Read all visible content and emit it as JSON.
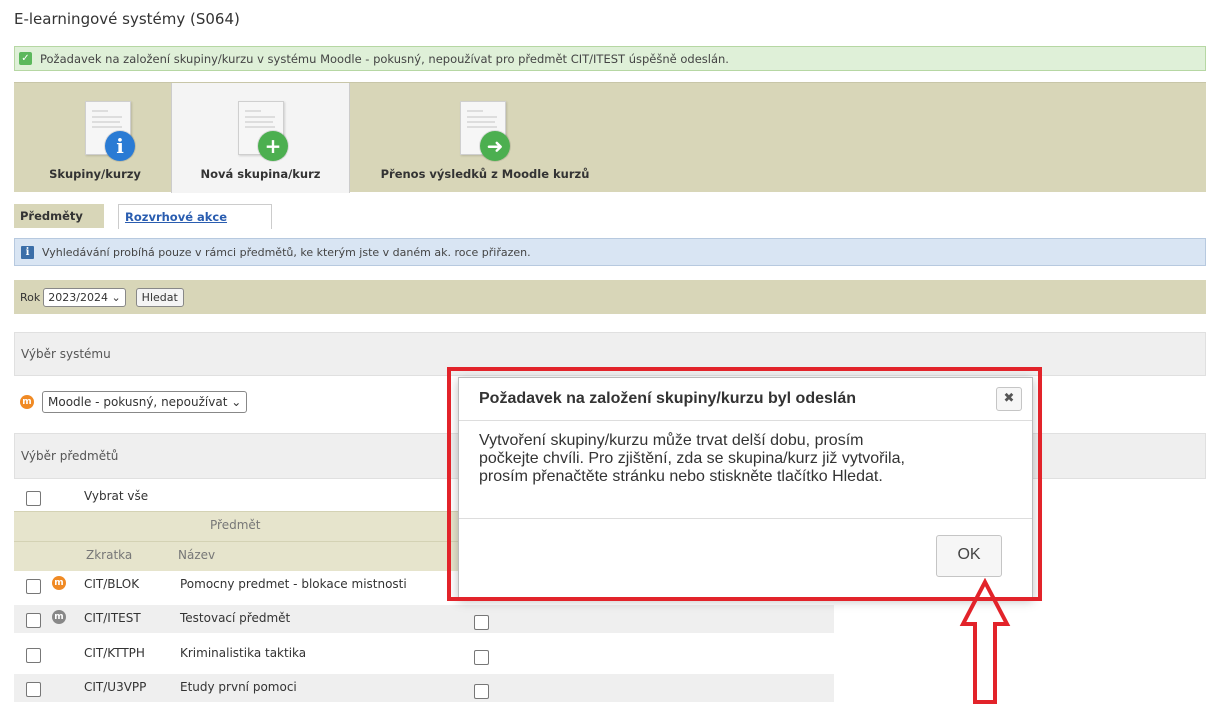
{
  "page": {
    "title": "E-learningové systémy (S064)"
  },
  "success": {
    "message": "Požadavek na založení skupiny/kurzu v systému Moodle - pokusný, nepoužívat pro předmět CIT/ITEST úspěšně odeslán.",
    "color": "#dff0d8"
  },
  "toolbar": {
    "items": [
      {
        "label": "Skupiny/kurzy",
        "icon": "info-icon",
        "color": "#2a7bd4"
      },
      {
        "label": "Nová skupina/kurz",
        "icon": "plus-icon",
        "color": "#4caf50",
        "active": true
      },
      {
        "label": "Přenos výsledků z Moodle kurzů",
        "icon": "arrow-right-icon",
        "color": "#4caf50"
      }
    ]
  },
  "tabs": [
    {
      "label": "Předměty",
      "active": true
    },
    {
      "label": "Rozvrhové akce",
      "active": false
    }
  ],
  "info": {
    "message": "Vyhledávání probíhá pouze v rámci předmětů, ke kterým jste v daném ak. roce přiřazen."
  },
  "filter": {
    "year_label": "Rok",
    "year_value": "2023/2024",
    "search_button": "Hledat"
  },
  "system": {
    "heading": "Výběr systému",
    "selected": "Moodle - pokusný, nepoužívat"
  },
  "subjects": {
    "heading": "Výběr předmětů",
    "select_all": "Vybrat vše",
    "group_header": "Předmět",
    "col_code": "Zkratka",
    "col_name": "Název",
    "rows": [
      {
        "code": "CIT/BLOK",
        "name": "Pomocny predmet - blokace mistnosti",
        "icon": "orange"
      },
      {
        "code": "CIT/ITEST",
        "name": "Testovací předmět",
        "icon": "grey"
      },
      {
        "code": "CIT/KTTPH",
        "name": "Kriminalistika taktika",
        "icon": ""
      },
      {
        "code": "CIT/U3VPP",
        "name": "Etudy první pomoci",
        "icon": ""
      }
    ]
  },
  "dialog": {
    "title": "Požadavek na založení skupiny/kurzu byl odeslán",
    "close_glyph": "✖",
    "lines": [
      "Vytvoření skupiny/kurzu může trvat delší dobu, prosím",
      "počkejte chvíli. Pro zjištění, zda se skupina/kurz již vytvořila,",
      "prosím přenačtěte stránku nebo stiskněte tlačítko Hledat."
    ],
    "ok": "OK"
  },
  "annotation": {
    "color": "#e2232a"
  }
}
